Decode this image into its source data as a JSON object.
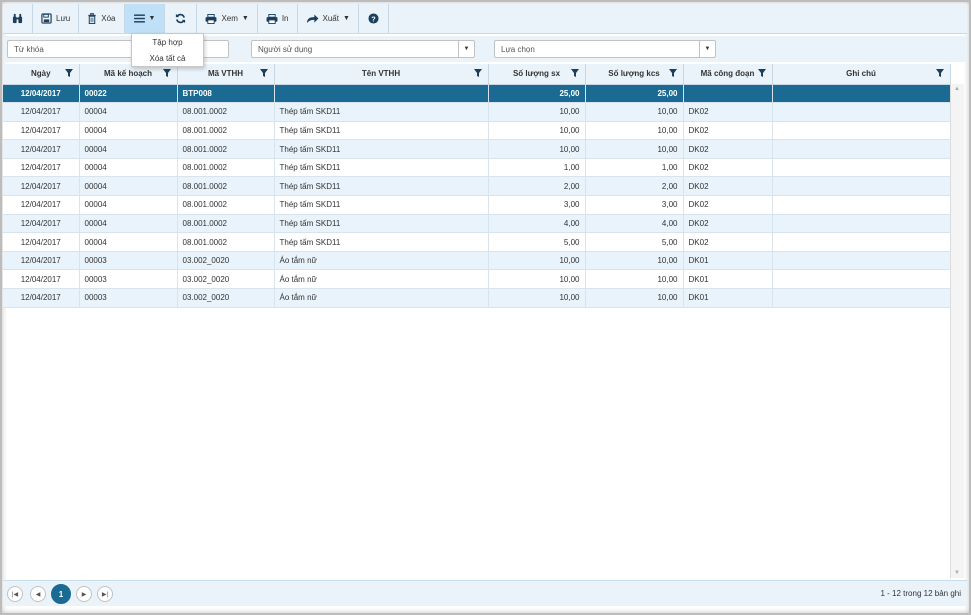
{
  "toolbar": {
    "save_label": "Lưu",
    "delete_label": "Xóa",
    "view_label": "Xem",
    "print_label": "In",
    "export_label": "Xuất"
  },
  "menu": {
    "items": [
      "Tập hợp",
      "Xóa tất cả"
    ]
  },
  "filters": {
    "keyword_placeholder": "Từ khóa",
    "user_placeholder": "Người sử dụng",
    "option_placeholder": "Lựa chọn"
  },
  "table": {
    "columns": [
      "Ngày",
      "Mã kế hoạch",
      "Mã VTHH",
      "Tên VTHH",
      "Số lượng sx",
      "Số lượng kcs",
      "Mã công đoạn",
      "Ghi chú"
    ],
    "rows": [
      [
        "12/04/2017",
        "00022",
        "BTP008",
        "",
        "25,00",
        "25,00",
        "",
        ""
      ],
      [
        "12/04/2017",
        "00004",
        "08.001.0002",
        "Thép tấm SKD11",
        "10,00",
        "10,00",
        "DK02",
        ""
      ],
      [
        "12/04/2017",
        "00004",
        "08.001.0002",
        "Thép tấm SKD11",
        "10,00",
        "10,00",
        "DK02",
        ""
      ],
      [
        "12/04/2017",
        "00004",
        "08.001.0002",
        "Thép tấm SKD11",
        "10,00",
        "10,00",
        "DK02",
        ""
      ],
      [
        "12/04/2017",
        "00004",
        "08.001.0002",
        "Thép tấm SKD11",
        "1,00",
        "1,00",
        "DK02",
        ""
      ],
      [
        "12/04/2017",
        "00004",
        "08.001.0002",
        "Thép tấm SKD11",
        "2,00",
        "2,00",
        "DK02",
        ""
      ],
      [
        "12/04/2017",
        "00004",
        "08.001.0002",
        "Thép tấm SKD11",
        "3,00",
        "3,00",
        "DK02",
        ""
      ],
      [
        "12/04/2017",
        "00004",
        "08.001.0002",
        "Thép tấm SKD11",
        "4,00",
        "4,00",
        "DK02",
        ""
      ],
      [
        "12/04/2017",
        "00004",
        "08.001.0002",
        "Thép tấm SKD11",
        "5,00",
        "5,00",
        "DK02",
        ""
      ],
      [
        "12/04/2017",
        "00003",
        "03.002_0020",
        "Áo tắm nữ",
        "10,00",
        "10,00",
        "DK01",
        ""
      ],
      [
        "12/04/2017",
        "00003",
        "03.002_0020",
        "Áo tắm nữ",
        "10,00",
        "10,00",
        "DK01",
        ""
      ],
      [
        "12/04/2017",
        "00003",
        "03.002_0020",
        "Áo tắm nữ",
        "10,00",
        "10,00",
        "DK01",
        ""
      ]
    ],
    "selected_row": 0
  },
  "pager": {
    "current_page": "1",
    "info": "1 - 12 trong 12 bản ghi"
  },
  "colors": {
    "accent": "#1b6a94",
    "toolbar_bg": "#eaf3fa",
    "alt_row": "#e8f3fb"
  }
}
